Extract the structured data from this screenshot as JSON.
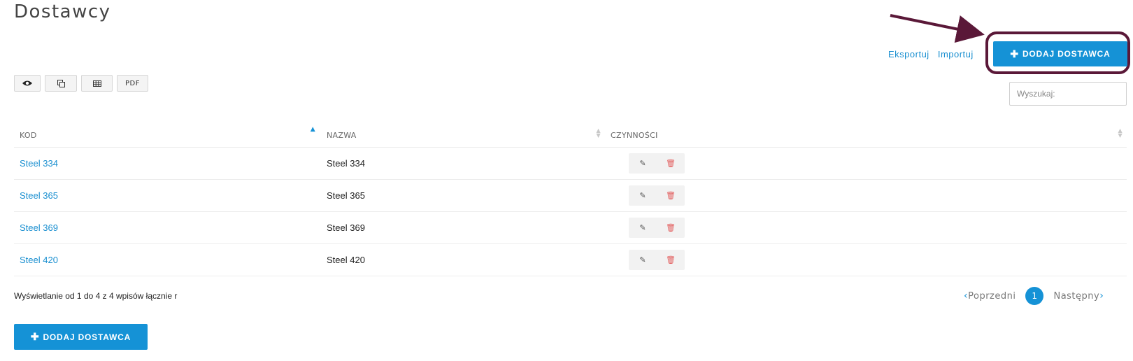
{
  "page": {
    "title": "Dostawcy"
  },
  "header_links": {
    "export": "Eksportuj",
    "import": "Importuj"
  },
  "add_button": {
    "label": "DODAJ DOSTAWCA",
    "icon": "plus-icon"
  },
  "toolbar": {
    "eye": "eye-icon",
    "copy": "copy-icon",
    "grid": "table-icon",
    "pdf": "PDF"
  },
  "search": {
    "placeholder": "Wyszukaj:"
  },
  "table": {
    "headers": {
      "kod": "KOD",
      "nazwa": "NAZWA",
      "czynnosci": "CZYNNOŚCI"
    },
    "rows": [
      {
        "kod": "Steel 334",
        "nazwa": "Steel 334"
      },
      {
        "kod": "Steel 365",
        "nazwa": "Steel 365"
      },
      {
        "kod": "Steel 369",
        "nazwa": "Steel 369"
      },
      {
        "kod": "Steel 420",
        "nazwa": "Steel 420"
      }
    ]
  },
  "info": "Wyświetlanie od 1 do 4 z 4 wpisów łącznie r",
  "pagination": {
    "prev": "Poprzedni",
    "current": "1",
    "next": "Następny"
  },
  "colors": {
    "accent": "#1592d6",
    "highlight": "#5a1838",
    "delete": "#e25b5b"
  }
}
